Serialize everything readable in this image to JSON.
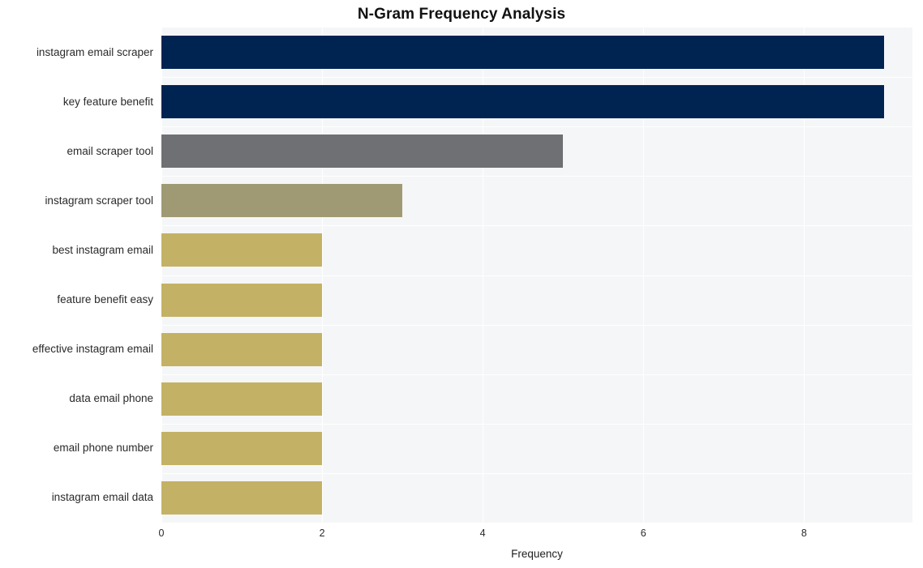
{
  "chart_data": {
    "type": "bar",
    "orientation": "horizontal",
    "title": "N-Gram Frequency Analysis",
    "xlabel": "Frequency",
    "ylabel": "",
    "categories": [
      "instagram email scraper",
      "key feature benefit",
      "email scraper tool",
      "instagram scraper tool",
      "best instagram email",
      "feature benefit easy",
      "effective instagram email",
      "data email phone",
      "email phone number",
      "instagram email data"
    ],
    "values": [
      9,
      9,
      5,
      3,
      2,
      2,
      2,
      2,
      2,
      2
    ],
    "bar_colors": [
      "#002452",
      "#002452",
      "#6e7073",
      "#a09a74",
      "#c3b265",
      "#c3b265",
      "#c3b265",
      "#c3b265",
      "#c3b265",
      "#c3b265"
    ],
    "xlim": [
      0,
      9.35
    ],
    "x_ticks": [
      0,
      2,
      4,
      6,
      8
    ],
    "x_tick_labels": [
      "0",
      "2",
      "4",
      "6",
      "8"
    ],
    "grid": true,
    "grid_color": "#ffffff",
    "plot_background": "#f5f6f7",
    "figure_background": "#ffffff",
    "legend": null
  }
}
